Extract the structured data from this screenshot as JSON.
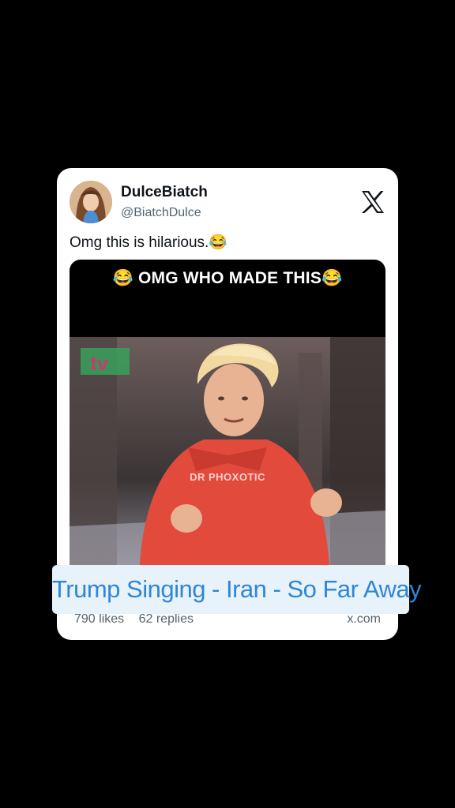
{
  "tweet": {
    "display_name": "DulceBiatch",
    "handle": "@BiatchDulce",
    "text": "Omg this is hilarious.😂",
    "media_caption": "😂 OMG WHO MADE THIS😂",
    "media_watermark": "DR PHOXOTIC",
    "likes": "790 likes",
    "replies": "62 replies",
    "source": "x.com"
  },
  "overlay": {
    "banner_text": "Trump Singing - Iran - So Far Away"
  },
  "icons": {
    "platform_logo": "x-logo-icon"
  },
  "colors": {
    "background": "#000000",
    "card": "#ffffff",
    "banner_bg": "#e8f2fb",
    "banner_text": "#2f86d4"
  }
}
